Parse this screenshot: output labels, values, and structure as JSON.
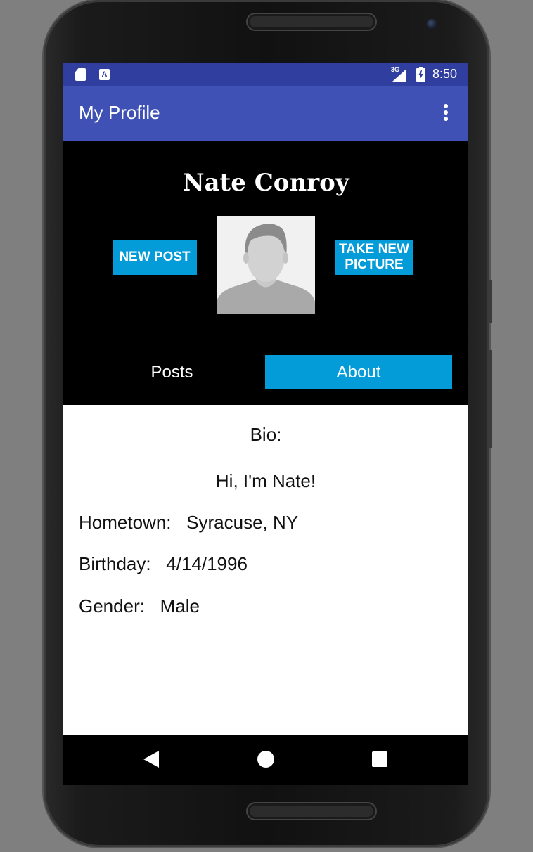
{
  "status_bar": {
    "network_type": "3G",
    "time": "8:50",
    "icons": [
      "sd-card-icon",
      "a-notification-icon",
      "signal-icon",
      "battery-charging-icon"
    ]
  },
  "app_bar": {
    "title": "My Profile",
    "overflow_icon": "more-vert-icon"
  },
  "profile": {
    "name": "Nate Conroy",
    "new_post_label": "NEW POST",
    "take_picture_label": "TAKE NEW PICTURE",
    "avatar_icon": "person-placeholder-icon"
  },
  "tabs": [
    {
      "label": "Posts",
      "selected": false
    },
    {
      "label": "About",
      "selected": true
    }
  ],
  "about": {
    "bio_label": "Bio:",
    "bio_text": "Hi, I'm Nate!",
    "hometown_row": "Hometown:   Syracuse, NY",
    "birthday_row": "Birthday:   4/14/1996",
    "gender_row": "Gender:   Male"
  },
  "nav_bar": {
    "icons": [
      "back-icon",
      "home-icon",
      "recents-icon"
    ]
  },
  "colors": {
    "status_bar": "#303f9f",
    "app_bar": "#3f51b5",
    "accent": "#039bd8",
    "screen_bg": "#000000",
    "content_bg": "#ffffff"
  }
}
